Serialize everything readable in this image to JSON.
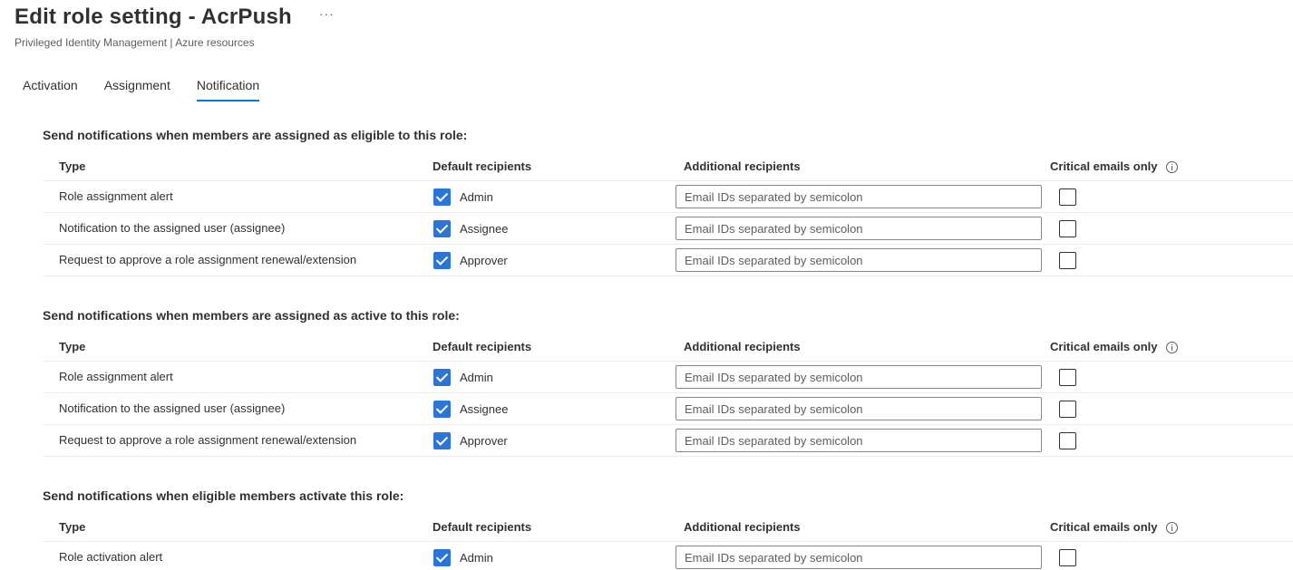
{
  "header": {
    "title": "Edit role setting - AcrPush",
    "more_label": "···",
    "breadcrumb": "Privileged Identity Management | Azure resources"
  },
  "tabs": [
    {
      "label": "Activation",
      "active": false
    },
    {
      "label": "Assignment",
      "active": false
    },
    {
      "label": "Notification",
      "active": true
    }
  ],
  "columns": {
    "type": "Type",
    "default": "Default recipients",
    "additional": "Additional recipients",
    "critical": "Critical emails only"
  },
  "email_placeholder": "Email IDs separated by semicolon",
  "sections": [
    {
      "title": "Send notifications when members are assigned as eligible to this role:",
      "rows": [
        {
          "type": "Role assignment alert",
          "default": "Admin",
          "default_checked": true,
          "critical_checked": false
        },
        {
          "type": "Notification to the assigned user (assignee)",
          "default": "Assignee",
          "default_checked": true,
          "critical_checked": false
        },
        {
          "type": "Request to approve a role assignment renewal/extension",
          "default": "Approver",
          "default_checked": true,
          "critical_checked": false
        }
      ]
    },
    {
      "title": "Send notifications when members are assigned as active to this role:",
      "rows": [
        {
          "type": "Role assignment alert",
          "default": "Admin",
          "default_checked": true,
          "critical_checked": false
        },
        {
          "type": "Notification to the assigned user (assignee)",
          "default": "Assignee",
          "default_checked": true,
          "critical_checked": false
        },
        {
          "type": "Request to approve a role assignment renewal/extension",
          "default": "Approver",
          "default_checked": true,
          "critical_checked": false
        }
      ]
    },
    {
      "title": "Send notifications when eligible members activate this role:",
      "rows": [
        {
          "type": "Role activation alert",
          "default": "Admin",
          "default_checked": true,
          "critical_checked": false
        }
      ]
    }
  ],
  "colors": {
    "accent": "#0078d4",
    "checkbox": "#2b75d6"
  }
}
